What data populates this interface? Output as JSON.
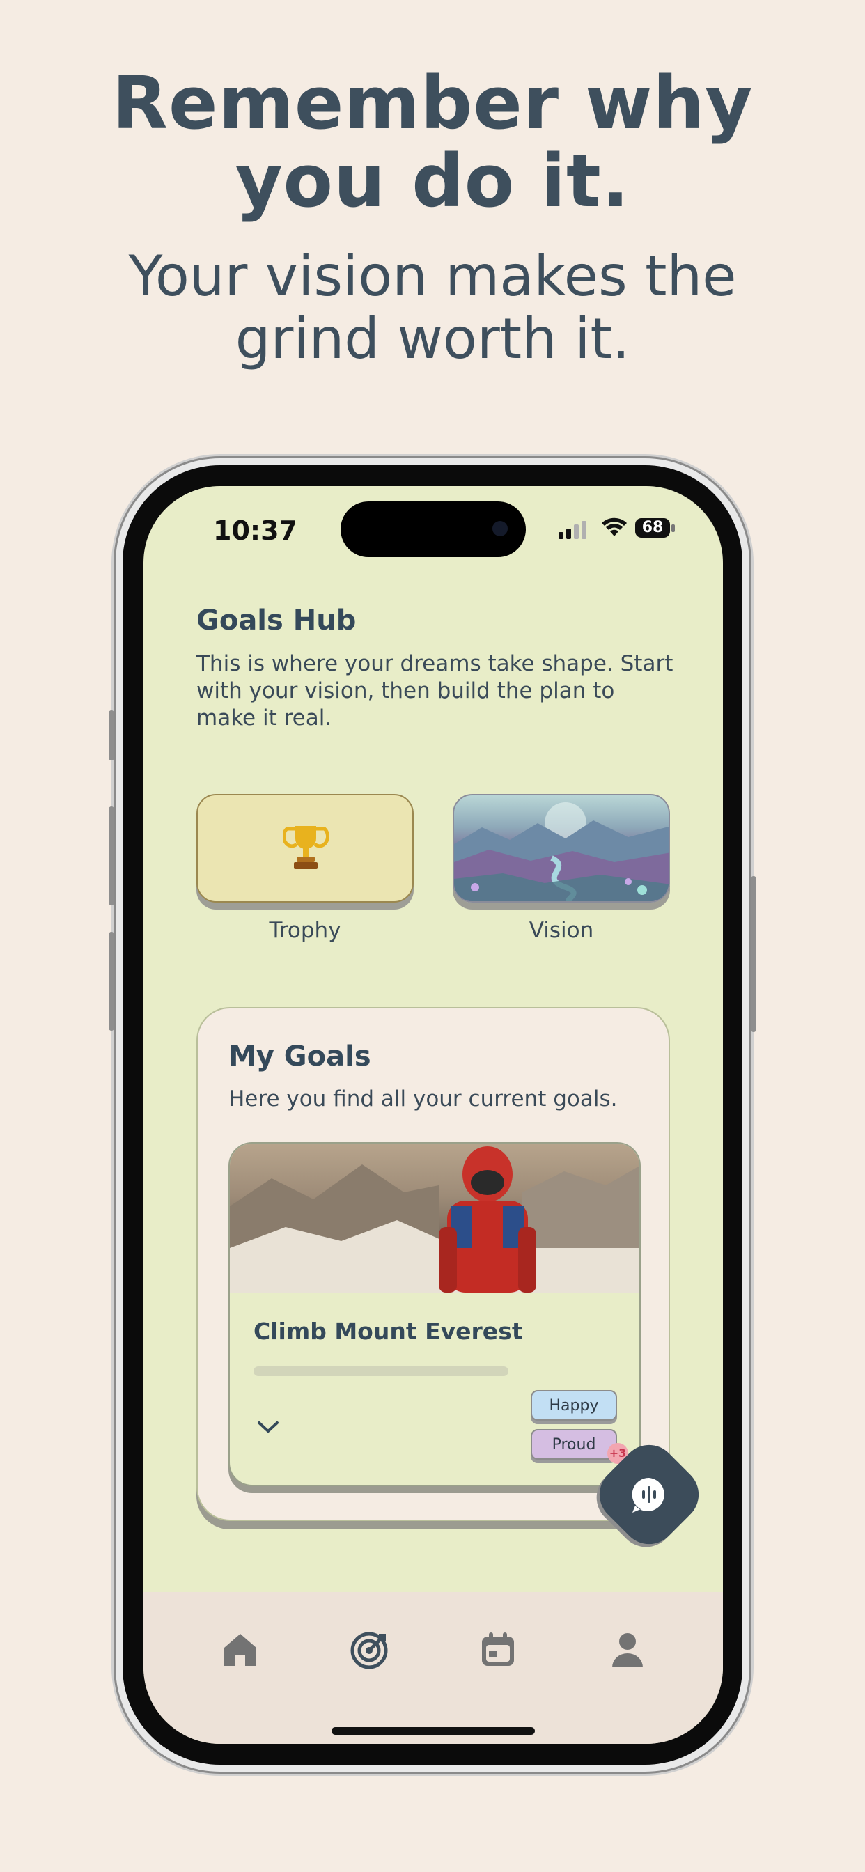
{
  "promo": {
    "headline_line1": "Remember why",
    "headline_line2": "you do it.",
    "subline_line1": "Your vision makes the",
    "subline_line2": "grind worth it."
  },
  "status_bar": {
    "time": "10:37",
    "battery": "68"
  },
  "hub": {
    "title": "Goals Hub",
    "description": "This is where your dreams take shape. Start with your vision, then build the plan to make it real."
  },
  "tiles": [
    {
      "label": "Trophy",
      "icon": "trophy-icon"
    },
    {
      "label": "Vision",
      "icon": "vision-landscape-image"
    }
  ],
  "my_goals": {
    "title": "My Goals",
    "description": "Here you find all your current goals.",
    "goals": [
      {
        "name": "Climb Mount Everest",
        "progress": 0,
        "tags": [
          "Happy",
          "Proud"
        ],
        "more_count": "+3"
      }
    ]
  },
  "tabbar": {
    "items": [
      "home-icon",
      "target-icon",
      "calendar-icon",
      "profile-icon"
    ],
    "active": "target-icon"
  },
  "colors": {
    "background": "#F5ECE3",
    "screen": "#E8EDC8",
    "ink": "#3E4F5D",
    "fab": "#3C4C5A"
  }
}
